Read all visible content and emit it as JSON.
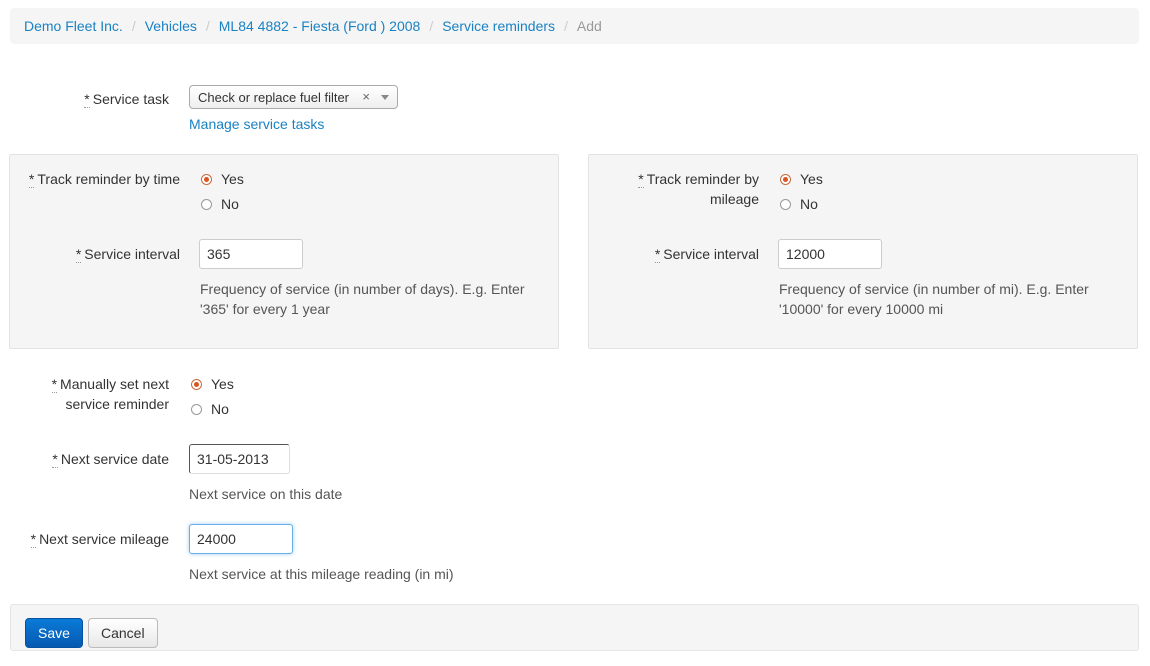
{
  "breadcrumb": {
    "items": [
      "Demo Fleet Inc.",
      "Vehicles",
      "ML84 4882 - Fiesta (Ford ) 2008",
      "Service reminders"
    ],
    "active": "Add",
    "separator": "/"
  },
  "service_task": {
    "label": "Service task",
    "required_mark": "*",
    "selected": "Check or replace fuel filter",
    "clear_glyph": "×",
    "manage_link": "Manage service tasks"
  },
  "time_panel": {
    "track_label": "Track reminder by time",
    "yes": "Yes",
    "no": "No",
    "selected": "Yes",
    "interval_label": "Service interval",
    "interval_value": "365",
    "help_line1": "Frequency of service (in number of days). E.g. Enter",
    "help_line2": "'365' for every 1 year"
  },
  "mileage_panel": {
    "track_label_line1": "Track reminder by",
    "track_label_line2": "mileage",
    "yes": "Yes",
    "no": "No",
    "selected": "Yes",
    "interval_label": "Service interval",
    "interval_value": "12000",
    "help_line1": "Frequency of service (in number of mi). E.g. Enter",
    "help_line2": "'10000' for every 10000 mi"
  },
  "manual": {
    "label_line1": "Manually set next",
    "label_line2": "service reminder",
    "yes": "Yes",
    "no": "No",
    "selected": "Yes"
  },
  "next_date": {
    "label": "Next service date",
    "value": "31-05-2013",
    "help": "Next service on this date"
  },
  "next_mileage": {
    "label": "Next service mileage",
    "value": "24000",
    "help": "Next service at this mileage reading (in mi)"
  },
  "actions": {
    "save": "Save",
    "cancel": "Cancel"
  },
  "colors": {
    "link": "#1a82c3",
    "primary": "#0a6fc9",
    "radio_checked": "#d9541e",
    "panel_bg": "#f5f5f5"
  }
}
